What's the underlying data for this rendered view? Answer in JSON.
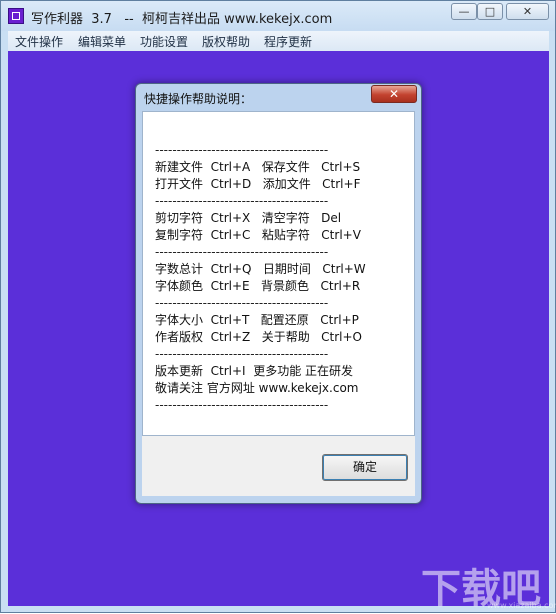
{
  "window": {
    "title": "写作利器  3.7   --  柯柯吉祥出品 www.kekejx.com",
    "controls": {
      "minimize": "—",
      "maximize": "□",
      "close": "✕"
    }
  },
  "menubar": {
    "items": [
      "文件操作",
      "编辑菜单",
      "功能设置",
      "版权帮助",
      "程序更新"
    ]
  },
  "dialog": {
    "title": "快捷操作帮助说明：",
    "close_label": "✕",
    "separator": "----------------------------------------",
    "lines": [
      "新建文件  Ctrl+A   保存文件   Ctrl+S",
      "打开文件  Ctrl+D   添加文件   Ctrl+F",
      "剪切字符  Ctrl+X   清空字符   Del",
      "复制字符  Ctrl+C   粘贴字符   Ctrl+V",
      "字数总计  Ctrl+Q   日期时间   Ctrl+W",
      "字体颜色  Ctrl+E   背景颜色   Ctrl+R",
      "字体大小  Ctrl+T   配置还原   Ctrl+P",
      "作者版权  Ctrl+Z   关于帮助   Ctrl+O",
      "版本更新  Ctrl+I  更多功能 正在研发",
      "敬请关注 官方网址 www.kekejx.com"
    ],
    "ok_label": "确定"
  },
  "watermark": {
    "text": "下载吧",
    "sub": "www.xiazaiba.com"
  },
  "colors": {
    "client_background": "#5b2fd9",
    "accent": "#3c7fb1"
  }
}
